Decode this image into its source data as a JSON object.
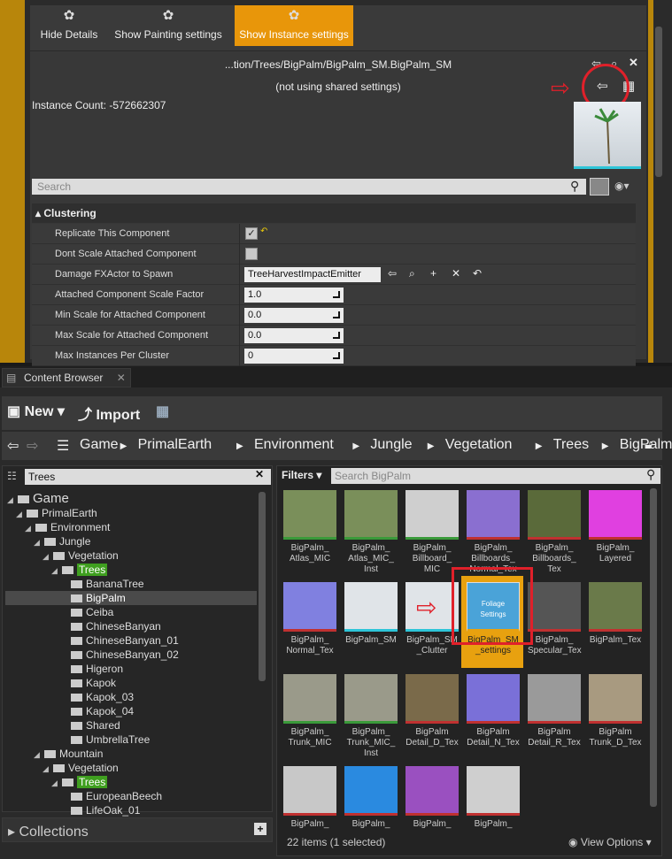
{
  "details": {
    "toolbar": [
      {
        "label": "Hide Details",
        "active": false
      },
      {
        "label": "Show Painting settings",
        "active": false
      },
      {
        "label": "Show Instance settings",
        "active": true
      }
    ],
    "path": "...tion/Trees/BigPalm/BigPalm_SM.BigPalm_SM",
    "shared": "(not using shared settings)",
    "instance_count": "Instance Count: -572662307",
    "search_placeholder": "Search",
    "section": "Clustering",
    "props": [
      {
        "label": "Replicate This Component",
        "type": "check",
        "value": "✓"
      },
      {
        "label": "Dont Scale Attached Component",
        "type": "check",
        "value": ""
      },
      {
        "label": "Damage FXActor to Spawn",
        "type": "dropdown",
        "value": "TreeHarvestImpactEmitter"
      },
      {
        "label": "Attached Component Scale Factor",
        "type": "number",
        "value": "1.0"
      },
      {
        "label": "Min Scale for Attached Component",
        "type": "number",
        "value": "0.0"
      },
      {
        "label": "Max Scale for Attached Component",
        "type": "number",
        "value": "0.0"
      },
      {
        "label": "Max Instances Per Cluster",
        "type": "number",
        "value": "0"
      }
    ]
  },
  "content_browser": {
    "tab": "Content Browser",
    "new_label": "New",
    "import_label": "Import",
    "breadcrumb": [
      "Game",
      "PrimalEarth",
      "Environment",
      "Jungle",
      "Vegetation",
      "Trees",
      "BigPalm"
    ],
    "folder_search": "Trees",
    "tree": [
      {
        "label": "Game",
        "depth": 0,
        "arrow": "◢",
        "big": true
      },
      {
        "label": "PrimalEarth",
        "depth": 1,
        "arrow": "◢"
      },
      {
        "label": "Environment",
        "depth": 2,
        "arrow": "◢"
      },
      {
        "label": "Jungle",
        "depth": 3,
        "arrow": "◢"
      },
      {
        "label": "Vegetation",
        "depth": 4,
        "arrow": "◢"
      },
      {
        "label": "Trees",
        "depth": 5,
        "arrow": "◢",
        "hl": true
      },
      {
        "label": "BananaTree",
        "depth": 6
      },
      {
        "label": "BigPalm",
        "depth": 6,
        "selected": true
      },
      {
        "label": "Ceiba",
        "depth": 6
      },
      {
        "label": "ChineseBanyan",
        "depth": 6
      },
      {
        "label": "ChineseBanyan_01",
        "depth": 6
      },
      {
        "label": "ChineseBanyan_02",
        "depth": 6
      },
      {
        "label": "Higeron",
        "depth": 6
      },
      {
        "label": "Kapok",
        "depth": 6
      },
      {
        "label": "Kapok_03",
        "depth": 6
      },
      {
        "label": "Kapok_04",
        "depth": 6
      },
      {
        "label": "Shared",
        "depth": 6
      },
      {
        "label": "UmbrellaTree",
        "depth": 6
      },
      {
        "label": "Mountain",
        "depth": 3,
        "arrow": "◢"
      },
      {
        "label": "Vegetation",
        "depth": 4,
        "arrow": "◢"
      },
      {
        "label": "Trees",
        "depth": 5,
        "arrow": "◢",
        "hl": true
      },
      {
        "label": "EuropeanBeech",
        "depth": 6
      },
      {
        "label": "LifeOak_01",
        "depth": 6
      }
    ],
    "collections": "Collections",
    "filters": "Filters",
    "asset_search": "Search BigPalm",
    "assets": [
      {
        "label": "BigPalm_\nAtlas_MIC",
        "color": "#7a8f5a",
        "bar": "#3a9a3a"
      },
      {
        "label": "BigPalm_\nAtlas_MIC_\nInst",
        "color": "#7a8f5a",
        "bar": "#3a9a3a"
      },
      {
        "label": "BigPalm_\nBillboard_\nMIC",
        "color": "#cfcfcf",
        "bar": "#3a9a3a"
      },
      {
        "label": "BigPalm_\nBillboards_\nNormal_Tex",
        "color": "#8a6fd0",
        "bar": "#c03030"
      },
      {
        "label": "BigPalm_\nBillboards_\nTex",
        "color": "#5a6a3a",
        "bar": "#c03030"
      },
      {
        "label": "BigPalm_\nLayered",
        "color": "#e040e0",
        "bar": "#c03030"
      },
      {
        "label": "BigPalm_\nNormal_Tex",
        "color": "#8080e0",
        "bar": "#c03030"
      },
      {
        "label": "BigPalm_SM",
        "color": "#e0e4e8",
        "bar": "#2ec5d8"
      },
      {
        "label": "BigPalm_SM\n_Clutter",
        "color": "#e0e4e8",
        "bar": "#2ec5d8"
      },
      {
        "label": "BigPalm_SM\n_settings",
        "color": "#4aa3d8",
        "bar": "#e8a10f",
        "selected": true
      },
      {
        "label": "BigPalm_\nSpecular_Tex",
        "color": "#555",
        "bar": "#c03030"
      },
      {
        "label": "BigPalm_Tex",
        "color": "#6a7a4a",
        "bar": "#c03030"
      },
      {
        "label": "BigPalm_\nTrunk_MIC",
        "color": "#9a9a8a",
        "bar": "#3a9a3a"
      },
      {
        "label": "BigPalm_\nTrunk_MIC_\nInst",
        "color": "#9a9a8a",
        "bar": "#3a9a3a"
      },
      {
        "label": "BigPalm\nDetail_D_Tex",
        "color": "#7a6a4a",
        "bar": "#c03030"
      },
      {
        "label": "BigPalm\nDetail_N_Tex",
        "color": "#7a70d8",
        "bar": "#c03030"
      },
      {
        "label": "BigPalm\nDetail_R_Tex",
        "color": "#9a9a9a",
        "bar": "#c03030"
      },
      {
        "label": "BigPalm\nTrunk_D_Tex",
        "color": "#a89a80",
        "bar": "#c03030"
      },
      {
        "label": "BigPalm_",
        "color": "#c8c8c8",
        "bar": "#c03030"
      },
      {
        "label": "BigPalm_",
        "color": "#2a8ae0",
        "bar": "#c03030"
      },
      {
        "label": "BigPalm_",
        "color": "#9a50c0",
        "bar": "#c03030"
      },
      {
        "label": "BigPalm_",
        "color": "#cfcfcf",
        "bar": "#c03030"
      }
    ],
    "foliage_tile_text": "Foliage\nSettings",
    "status": "22 items (1 selected)",
    "view_options": "View Options"
  }
}
